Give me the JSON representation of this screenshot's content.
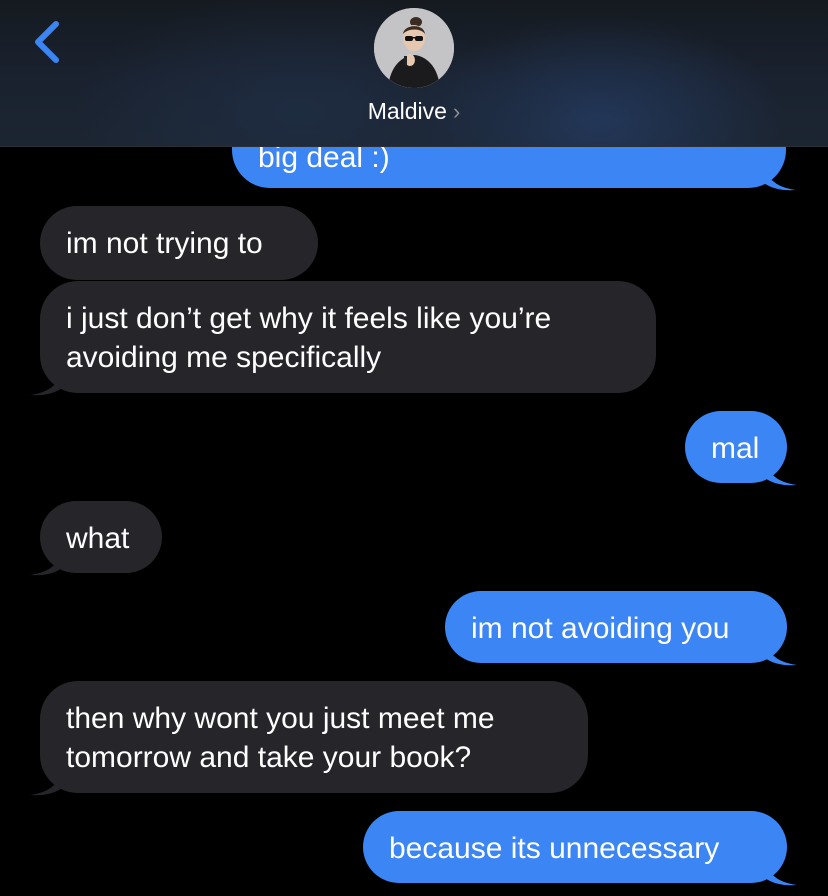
{
  "header": {
    "back_icon": "chevron-left-icon",
    "contact_name": "Maldive",
    "contact_chevron": "›",
    "accent_color": "#3b86f4"
  },
  "messages": [
    {
      "direction": "out",
      "text": "big deal :)"
    },
    {
      "direction": "in",
      "text": "im not trying to"
    },
    {
      "direction": "in",
      "lines": [
        "i just don’t get why it feels like you’re",
        "avoiding me specifically"
      ]
    },
    {
      "direction": "out",
      "text": "mal"
    },
    {
      "direction": "in",
      "text": "what"
    },
    {
      "direction": "out",
      "text": "im not avoiding you"
    },
    {
      "direction": "in",
      "lines": [
        "then why wont you just meet me",
        "tomorrow and take your book?"
      ]
    },
    {
      "direction": "out",
      "text": "because its unnecessary"
    }
  ],
  "colors": {
    "incoming_bubble": "#26252a",
    "outgoing_bubble": "#3b86f4",
    "background": "#000000"
  }
}
